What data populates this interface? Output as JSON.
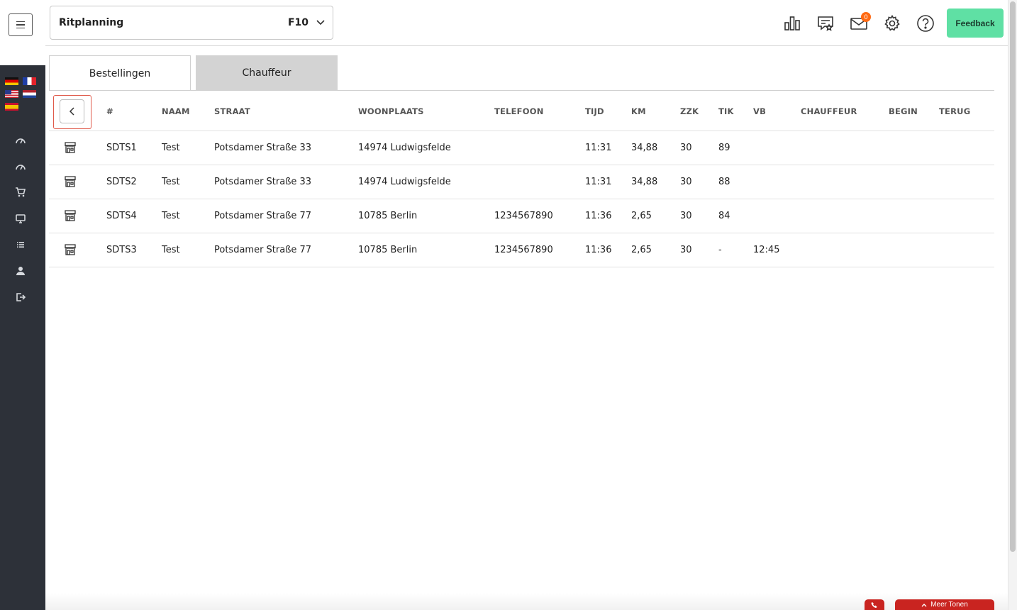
{
  "header": {
    "selector_title": "Ritplanning",
    "selector_code": "F10",
    "mail_count": "0",
    "feedback_label": "Feedback"
  },
  "sidebar": {
    "flags": [
      "de-flag",
      "fr-flag",
      "us-flag",
      "nl-flag",
      "es-flag"
    ],
    "icons": [
      "dashboard-icon",
      "dashboard-icon",
      "cart-icon",
      "monitor-icon",
      "list-icon",
      "user-icon",
      "logout-icon"
    ]
  },
  "tabs": [
    {
      "label": "Bestellingen",
      "active": true
    },
    {
      "label": "Chauffeur",
      "active": false
    }
  ],
  "table": {
    "columns": [
      "#",
      "NAAM",
      "STRAAT",
      "WOONPLAATS",
      "TELEFOON",
      "TIJD",
      "KM",
      "ZZK",
      "TIK",
      "VB",
      "CHAUFFEUR",
      "BEGIN",
      "TERUG"
    ],
    "rows": [
      {
        "id": "SDTS1",
        "naam": "Test",
        "straat": "Potsdamer Straße 33",
        "woonplaats": "14974 Ludwigsfelde",
        "telefoon": "",
        "tijd": "11:31",
        "km": "34,88",
        "zzk": "30",
        "tik": "89",
        "vb": "",
        "chauffeur": "",
        "begin": "",
        "terug": ""
      },
      {
        "id": "SDTS2",
        "naam": "Test",
        "straat": "Potsdamer Straße 33",
        "woonplaats": "14974 Ludwigsfelde",
        "telefoon": "",
        "tijd": "11:31",
        "km": "34,88",
        "zzk": "30",
        "tik": "88",
        "vb": "",
        "chauffeur": "",
        "begin": "",
        "terug": ""
      },
      {
        "id": "SDTS4",
        "naam": "Test",
        "straat": "Potsdamer Straße 77",
        "woonplaats": "10785 Berlin",
        "telefoon": "1234567890",
        "tijd": "11:36",
        "km": "2,65",
        "zzk": "30",
        "tik": "84",
        "vb": "",
        "chauffeur": "",
        "begin": "",
        "terug": ""
      },
      {
        "id": "SDTS3",
        "naam": "Test",
        "straat": "Potsdamer Straße 77",
        "woonplaats": "10785 Berlin",
        "telefoon": "1234567890",
        "tijd": "11:36",
        "km": "2,65",
        "zzk": "30",
        "tik": "-",
        "vb": "12:45",
        "chauffeur": "",
        "begin": "",
        "terug": ""
      }
    ]
  },
  "footer": {
    "more_label": "Meer Tonen"
  },
  "colors": {
    "sidebar_bg": "#2d3139",
    "feedback_bg": "#5fe0a4",
    "badge_bg": "#ff6a13",
    "focus_outline": "#e05a4a",
    "footer_button_bg": "#c92420"
  }
}
